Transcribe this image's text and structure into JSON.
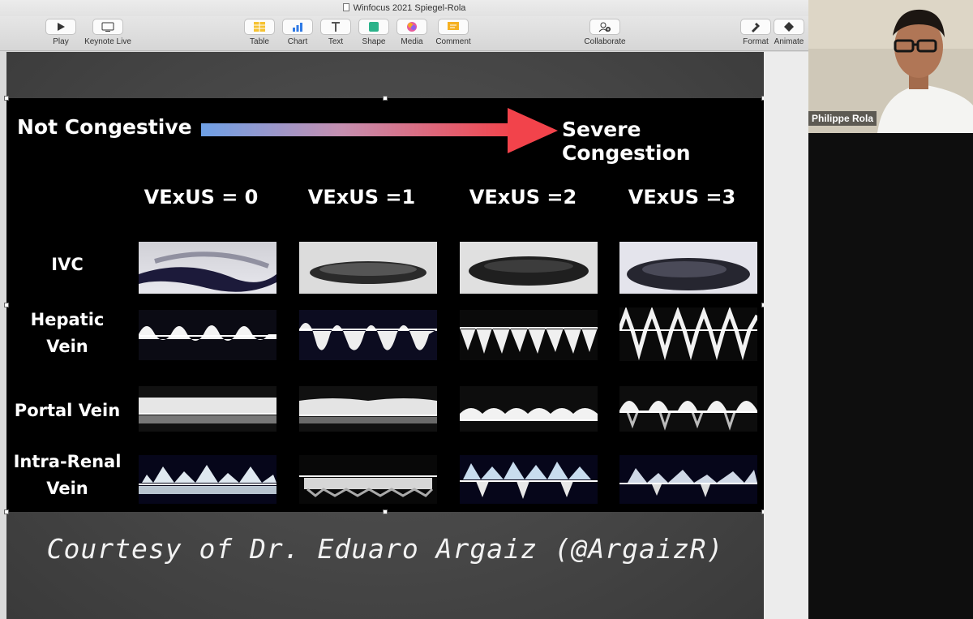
{
  "window": {
    "title": "Winfocus 2021 Spiegel-Rola"
  },
  "toolbar": {
    "play": "Play",
    "keynote_live": "Keynote Live",
    "table": "Table",
    "chart": "Chart",
    "text": "Text",
    "shape": "Shape",
    "media": "Media",
    "comment": "Comment",
    "collaborate": "Collaborate",
    "format": "Format",
    "animate": "Animate"
  },
  "slide": {
    "left_label": "Not Congestive",
    "right_label": "Severe Congestion",
    "columns": [
      "VExUS = 0",
      "VExUS =1",
      "VExUS =2",
      "VExUS =3"
    ],
    "rows": [
      {
        "line1": "IVC",
        "line2": ""
      },
      {
        "line1": "Hepatic",
        "line2": "Vein"
      },
      {
        "line1": "Portal Vein",
        "line2": ""
      },
      {
        "line1": "Intra-Renal",
        "line2": "Vein"
      }
    ],
    "courtesy": "Courtesy of Dr. Eduaro Argaiz (@ArgaizR)"
  },
  "colors": {
    "arrow_start": "#6ea0e6",
    "arrow_end": "#f2434b",
    "slide_bg": "#4a4a4a"
  },
  "webcam": {
    "participant_name": "Philippe Rola"
  }
}
